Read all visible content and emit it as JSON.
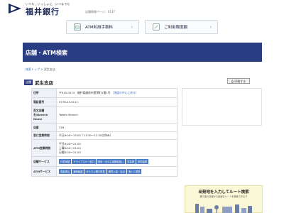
{
  "header": {
    "tagline": "いつも、いっしょに、いつまでも",
    "bank_name": "福井銀行",
    "note": "店舗情報ページ：0137"
  },
  "quick_buttons": [
    {
      "label": "ATM利用手数料"
    },
    {
      "label": "ご利用限度額"
    }
  ],
  "page_title": "店舗・ATM検索",
  "breadcrumb": {
    "home": "検索トップ",
    "sep": ">",
    "current": "武生支店"
  },
  "branch": {
    "badge": "店舗",
    "name": "武生支店"
  },
  "print_button": "印刷する",
  "info": {
    "address_label": "住所",
    "address_value": "〒915-0074　福井県越前市蓬莱町1番1号",
    "map_link": "［地図の中心に戻る］",
    "phone_label": "電話番号",
    "phone_value": "0778-23-5111",
    "name_en_label": "英文店舗名/Branch Name",
    "name_en_value": "Takefu Branch",
    "code_label": "店番",
    "code_value": "339",
    "window_label": "窓口営業時間",
    "window_value": "平日9:00～15:00（11:30～12:30は休み）",
    "atm_hours_label": "ATM営業時間",
    "atm_hours": [
      "平日8:00～21:00",
      "土曜8:00～21:00",
      "日曜8:00～21:00"
    ],
    "store_services_label": "店舗サービス",
    "store_services": [
      "外貨両替",
      "ドライブスルー窓口",
      "投信・ぜんむ保険取扱い",
      "貸金庫",
      "夜間金庫"
    ],
    "atm_services_label": "ATMサービス",
    "atm_services": [
      "現金振込",
      "通帳繰越",
      "ゆうちょ銀行提携",
      "硬貨入金・払出",
      "宝くじ提携"
    ]
  },
  "route": {
    "title": "出発地を入力してルート検索",
    "subtitle": "乗り換え情報から最適なルートを検索できます"
  },
  "colors": {
    "brand_navy": "#2a3d82",
    "tag_blue": "#4a7cc7",
    "link_blue": "#3a6ec4"
  }
}
